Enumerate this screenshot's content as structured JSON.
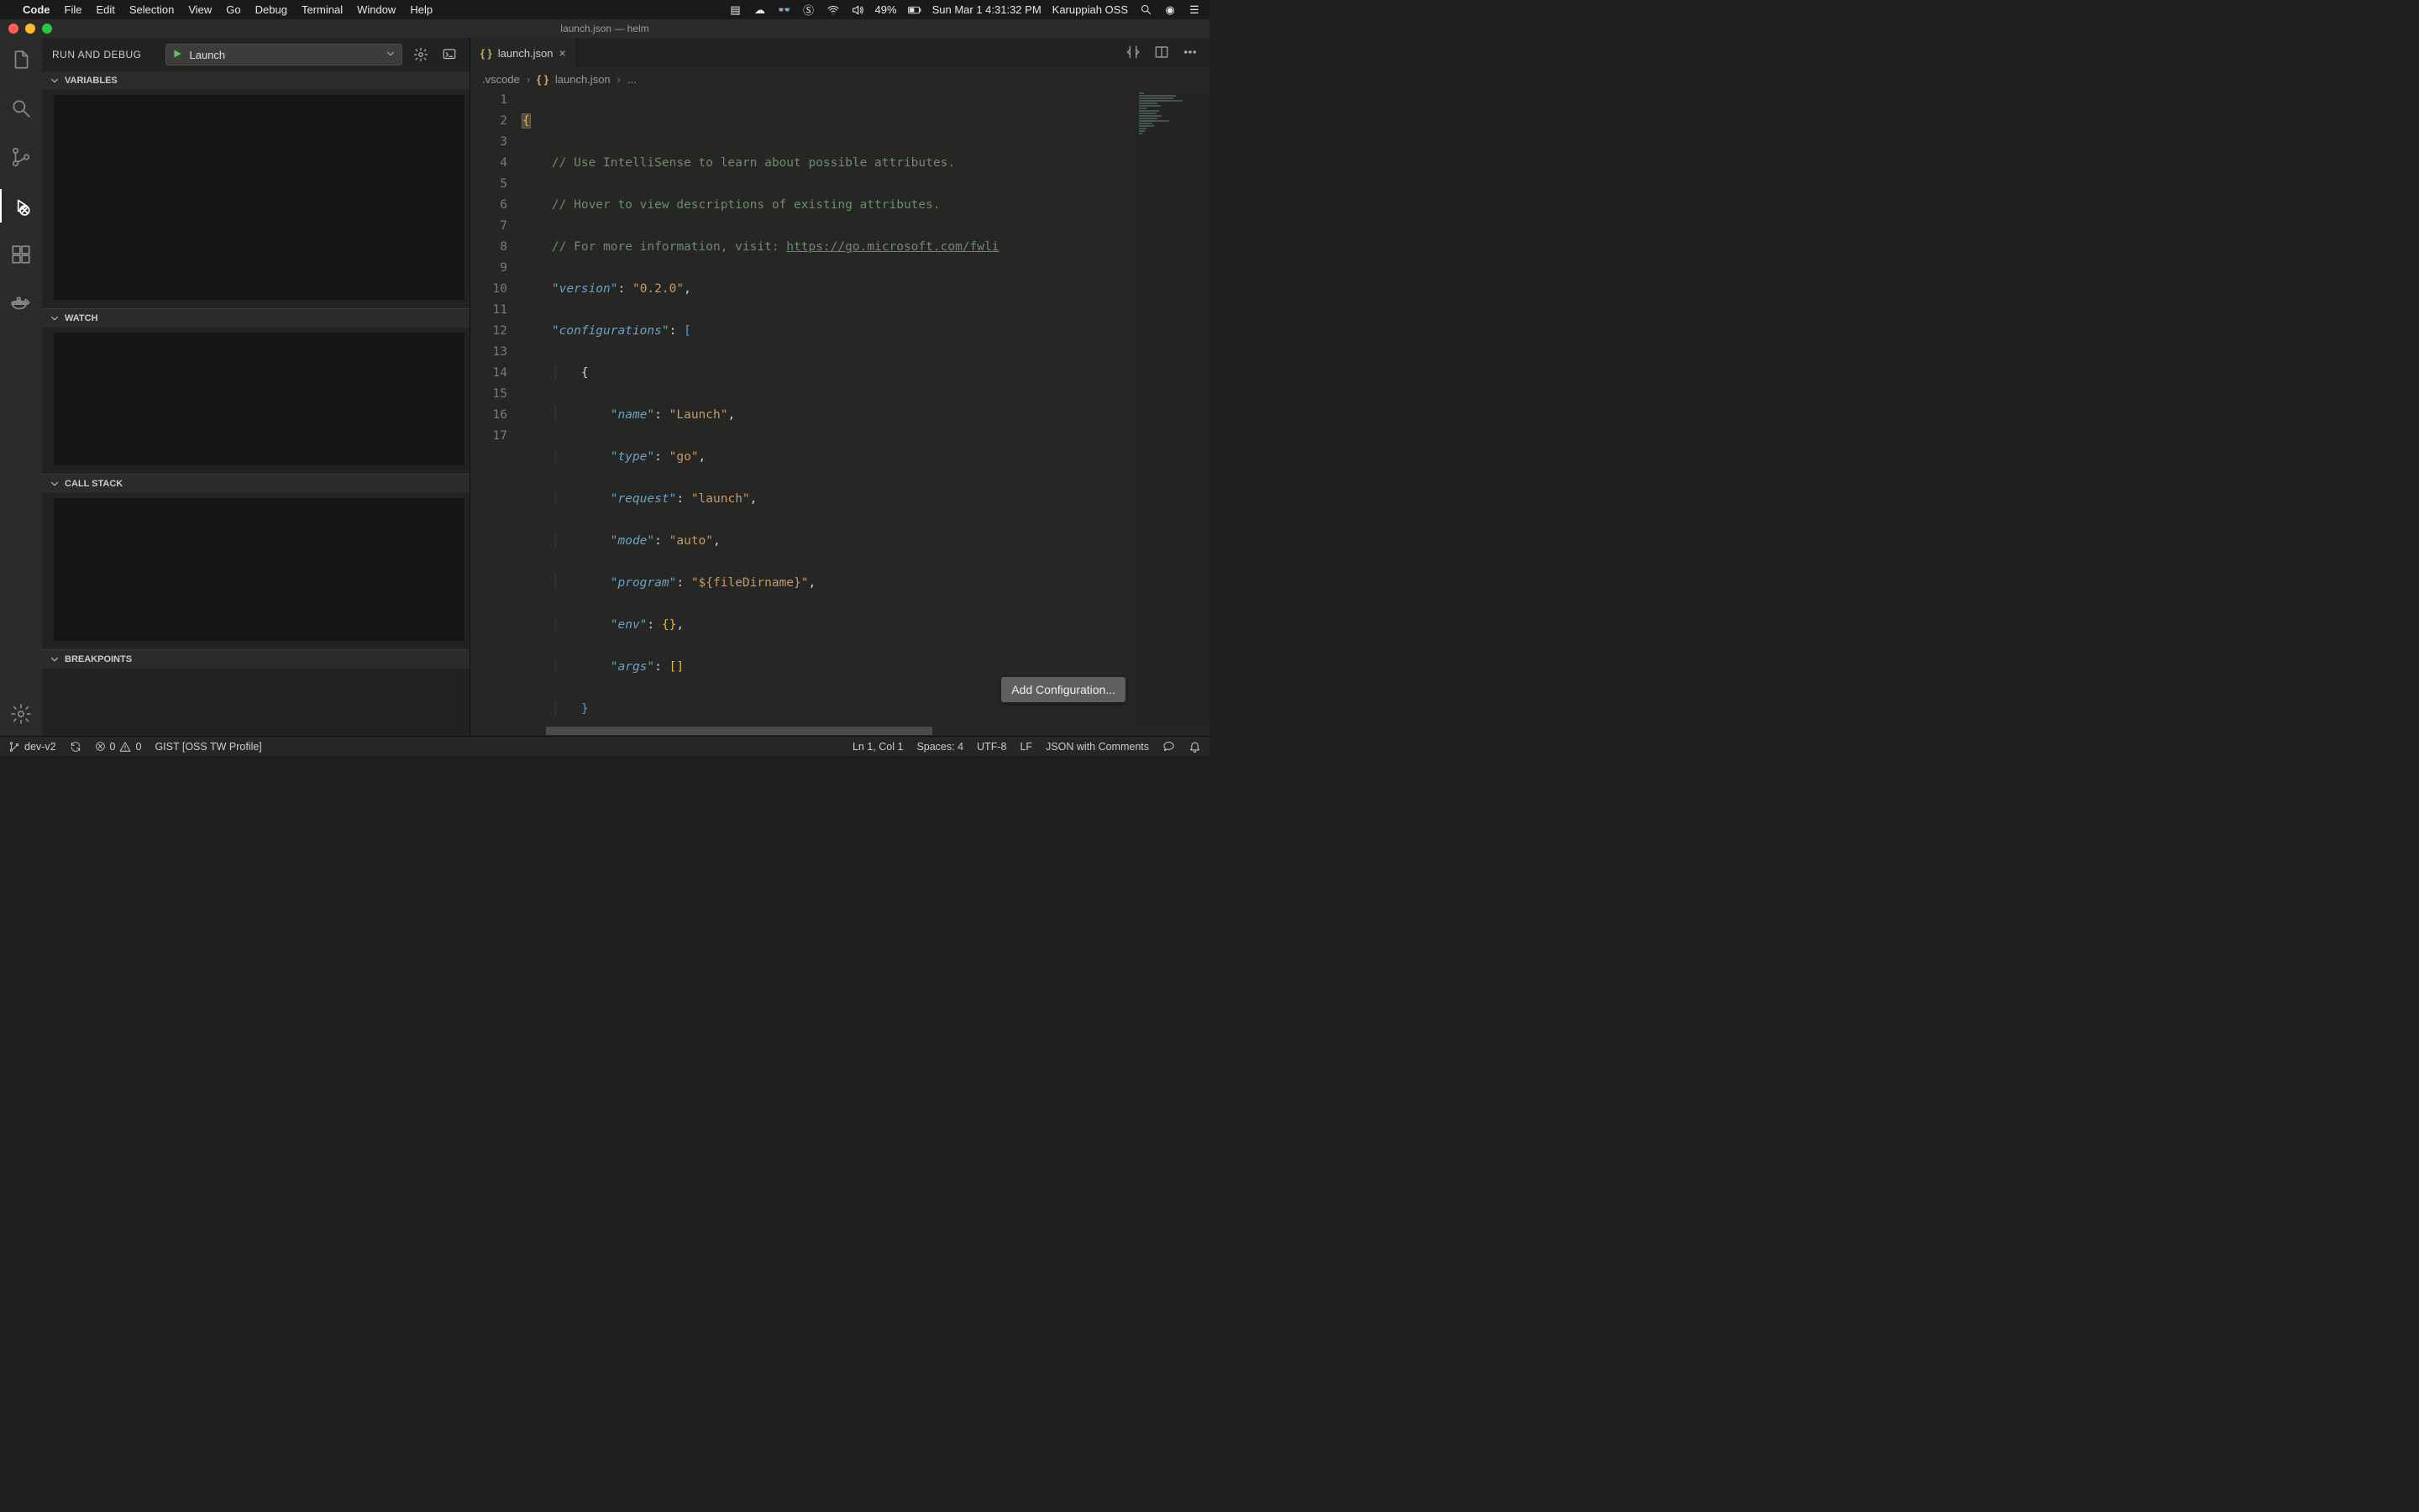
{
  "menubar": {
    "app": "Code",
    "items": [
      "File",
      "Edit",
      "Selection",
      "View",
      "Go",
      "Debug",
      "Terminal",
      "Window",
      "Help"
    ],
    "right": {
      "battery_pct": "49%",
      "datetime": "Sun Mar 1  4:31:32 PM",
      "user": "Karuppiah OSS"
    }
  },
  "titlebar": {
    "title": "launch.json — helm"
  },
  "sidebar": {
    "title": "RUN AND DEBUG",
    "config_name": "Launch",
    "sections": {
      "variables": "VARIABLES",
      "watch": "WATCH",
      "callstack": "CALL STACK",
      "breakpoints": "BREAKPOINTS"
    }
  },
  "tabs": {
    "file": "launch.json"
  },
  "breadcrumb": {
    "folder": ".vscode",
    "file": "launch.json",
    "more": "..."
  },
  "editor": {
    "add_config_label": "Add Configuration...",
    "lines": 17,
    "comment1": "// Use IntelliSense to learn about possible attributes.",
    "comment2": "// Hover to view descriptions of existing attributes.",
    "comment3_prefix": "// For more information, visit: ",
    "comment3_url": "https://go.microsoft.com/fwli",
    "kv": {
      "version_key": "\"version\"",
      "version_val": "\"0.2.0\"",
      "configurations_key": "\"configurations\"",
      "name_key": "\"name\"",
      "name_val": "\"Launch\"",
      "type_key": "\"type\"",
      "type_val": "\"go\"",
      "request_key": "\"request\"",
      "request_val": "\"launch\"",
      "mode_key": "\"mode\"",
      "mode_val": "\"auto\"",
      "program_key": "\"program\"",
      "program_val": "\"${fileDirname}\"",
      "env_key": "\"env\"",
      "args_key": "\"args\""
    }
  },
  "statusbar": {
    "branch": "dev-v2",
    "errors": "0",
    "warnings": "0",
    "gist": "GIST [OSS TW Profile]",
    "cursor": "Ln 1, Col 1",
    "spaces": "Spaces: 4",
    "encoding": "UTF-8",
    "eol": "LF",
    "language": "JSON with Comments"
  }
}
